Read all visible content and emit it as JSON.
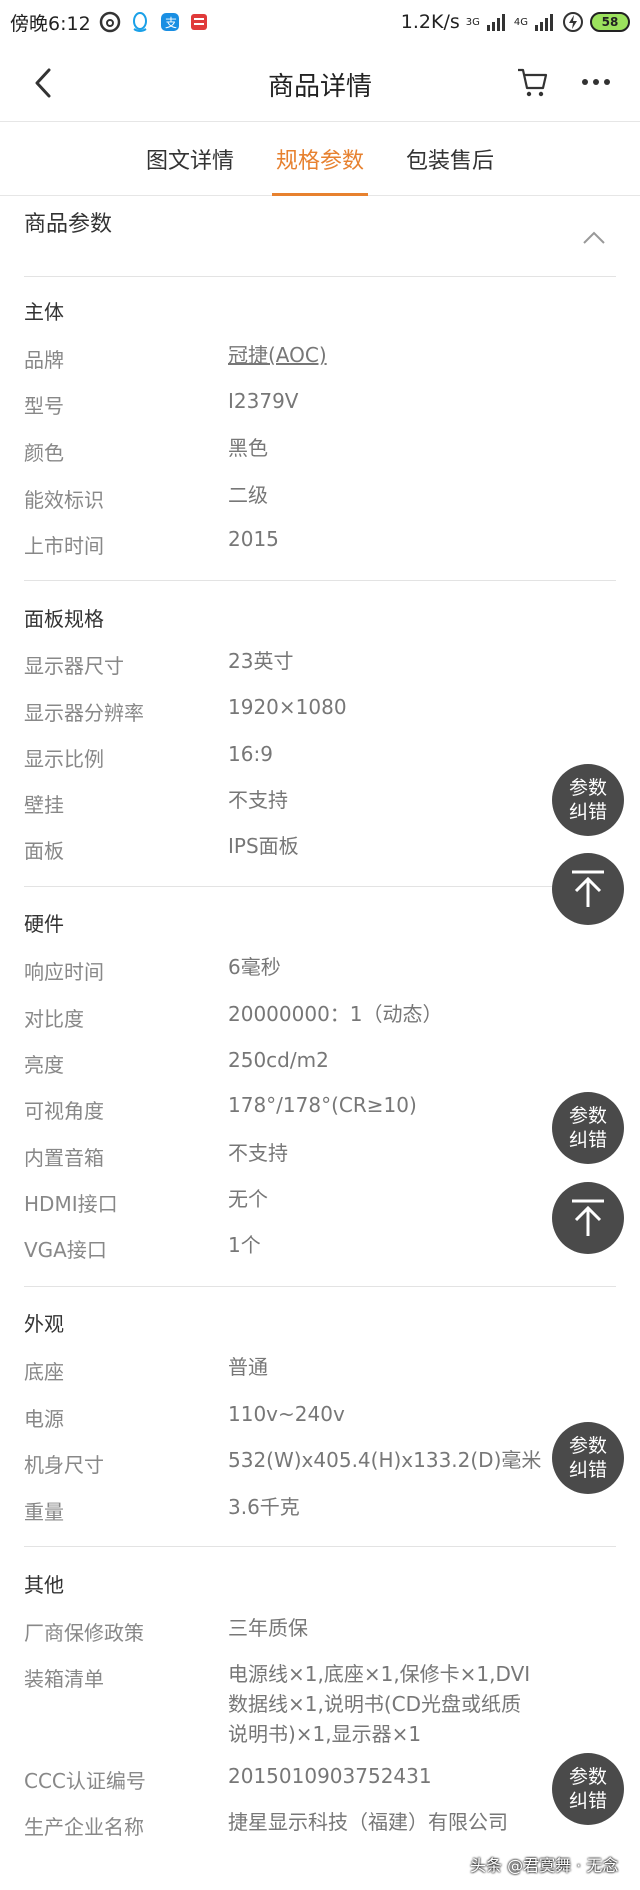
{
  "status_bar": {
    "time": "傍晚6:12",
    "speed": "1.2K/s",
    "net1": "3G",
    "net2": "4G",
    "battery": "58"
  },
  "nav": {
    "title": "商品详情"
  },
  "tabs": [
    {
      "label": "图文详情"
    },
    {
      "label": "规格参数"
    },
    {
      "label": "包装售后"
    }
  ],
  "params_title": "商品参数",
  "groups": {
    "main": {
      "title": "主体",
      "rows": [
        {
          "label": "品牌",
          "value": "冠捷(AOC)"
        },
        {
          "label": "型号",
          "value": "I2379V"
        },
        {
          "label": "颜色",
          "value": "黑色"
        },
        {
          "label": "能效标识",
          "value": "二级"
        },
        {
          "label": "上市时间",
          "value": "2015"
        }
      ]
    },
    "panel": {
      "title": "面板规格",
      "rows": [
        {
          "label": "显示器尺寸",
          "value": "23英寸"
        },
        {
          "label": "显示器分辨率",
          "value": "1920×1080"
        },
        {
          "label": "显示比例",
          "value": "16:9"
        },
        {
          "label": "壁挂",
          "value": "不支持"
        },
        {
          "label": "面板",
          "value": "IPS面板"
        }
      ]
    },
    "hardware": {
      "title": "硬件",
      "rows": [
        {
          "label": "响应时间",
          "value": "6毫秒"
        },
        {
          "label": "对比度",
          "value": "20000000：1（动态）"
        },
        {
          "label": "亮度",
          "value": "250cd/m2"
        },
        {
          "label": "可视角度",
          "value": "178°/178°(CR≥10)"
        },
        {
          "label": "内置音箱",
          "value": "不支持"
        },
        {
          "label": "HDMI接口",
          "value": "无个"
        },
        {
          "label": "VGA接口",
          "value": "1个"
        }
      ]
    },
    "appearance": {
      "title": "外观",
      "rows": [
        {
          "label": "底座",
          "value": "普通"
        },
        {
          "label": "电源",
          "value": "110v~240v"
        },
        {
          "label": "机身尺寸",
          "value": "532(W)x405.4(H)x133.2(D)毫米"
        },
        {
          "label": "重量",
          "value": "3.6千克"
        }
      ]
    },
    "other": {
      "title": "其他",
      "rows": [
        {
          "label": "厂商保修政策",
          "value": "三年质保"
        },
        {
          "label": "装箱清单",
          "value": "电源线×1,底座×1,保修卡×1,DVI数据线×1,说明书(CD光盘或纸质说明书)×1,显示器×1"
        },
        {
          "label": "CCC认证编号",
          "value": "2015010903752431"
        },
        {
          "label": "生产企业名称",
          "value": "捷星显示科技（福建）有限公司"
        }
      ]
    }
  },
  "float": {
    "correction_line1": "参数",
    "correction_line2": "纠错"
  },
  "watermark": "头条 @君寞舞 · 无念"
}
